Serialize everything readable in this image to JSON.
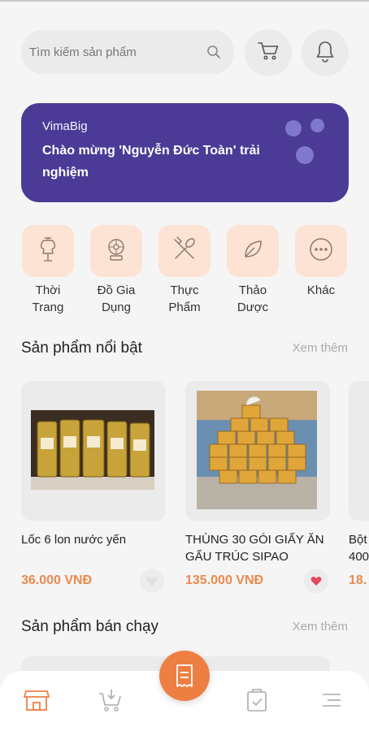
{
  "header": {
    "search_placeholder": "Tìm kiếm sản phẩm",
    "cart_icon": "cart-icon",
    "bell_icon": "bell-icon"
  },
  "banner": {
    "brand": "VimaBig",
    "welcome": "Chào mừng 'Nguyễn Đức Toàn' trải nghiệm",
    "background_color": "#4b3a96"
  },
  "categories": [
    {
      "label": "Thời Trang",
      "icon": "mannequin-icon"
    },
    {
      "label": "Đồ Gia Dụng",
      "icon": "appliance-icon"
    },
    {
      "label": "Thực Phẩm",
      "icon": "fork-spoon-icon"
    },
    {
      "label": "Thảo Dược",
      "icon": "leaf-icon"
    },
    {
      "label": "Khác",
      "icon": "more-icon"
    }
  ],
  "featured": {
    "title": "Sản phẩm nổi bật",
    "more": "Xem thêm",
    "products": [
      {
        "name": "Lốc 6 lon nước yến",
        "price": "36.000 VNĐ",
        "favorited": false
      },
      {
        "name": "THÙNG 30 GÓI GIẤY ĂN GẤU TRÚC SIPAO",
        "price": "135.000 VNĐ",
        "favorited": true
      },
      {
        "name": "Bột 400",
        "price": "18.",
        "favorited": false
      }
    ]
  },
  "bestsellers": {
    "title": "Sản phẩm bán chạy",
    "more": "Xem thêm"
  },
  "nav": {
    "items": [
      "home-store-icon",
      "cart-download-icon",
      "receipt-icon",
      "order-check-icon",
      "menu-icon"
    ],
    "accent": "#ee7f42"
  }
}
